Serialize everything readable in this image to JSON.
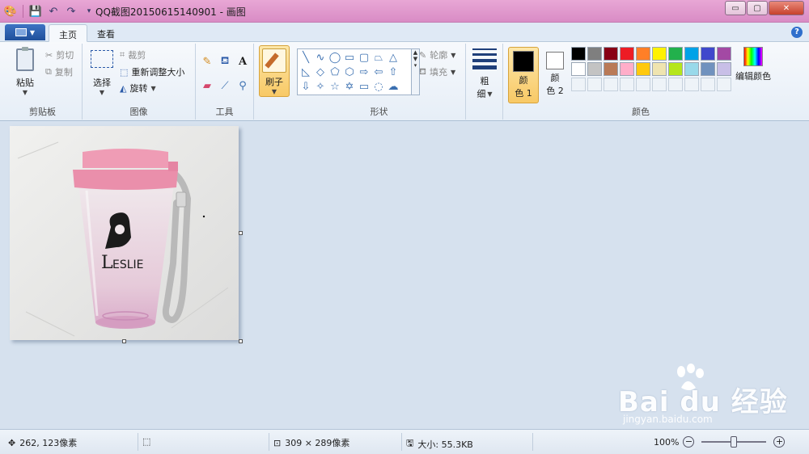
{
  "titlebar": {
    "title": "QQ截图20150615140901 - 画图",
    "controls": {
      "minimize": "▭",
      "maximize": "▢",
      "close": "✕"
    }
  },
  "tabs": {
    "main": "主页",
    "view": "查看",
    "help": "?"
  },
  "clipboard": {
    "paste": "粘贴",
    "cut": "剪切",
    "copy": "复制",
    "label": "剪贴板"
  },
  "image_group": {
    "select": "选择",
    "crop": "裁剪",
    "resize": "重新调整大小",
    "rotate": "旋转",
    "label": "图像"
  },
  "tools_group": {
    "label": "工具",
    "text_tool": "A"
  },
  "brush": {
    "label": "刷子"
  },
  "shapes_group": {
    "outline": "轮廓",
    "fill": "填充",
    "label": "形状"
  },
  "size_group": {
    "line1": "粗",
    "line2": "细"
  },
  "colors_group": {
    "color1_line1": "颜",
    "color1_line2": "色 1",
    "color2_line1": "颜",
    "color2_line2": "色 2",
    "color1_value": "#000000",
    "color2_value": "#ffffff",
    "edit_colors": "编辑颜色",
    "label": "颜色",
    "palette_row1": [
      "#000000",
      "#7f7f7f",
      "#880015",
      "#ed1c24",
      "#ff7f27",
      "#fff200",
      "#22b14c",
      "#00a2e8",
      "#3f48cc",
      "#a349a4"
    ],
    "palette_row2": [
      "#ffffff",
      "#c3c3c3",
      "#b97a57",
      "#ffaec9",
      "#ffc90e",
      "#efe4b0",
      "#b5e61d",
      "#99d9ea",
      "#7092be",
      "#c8bfe7"
    ]
  },
  "canvas": {
    "logo_text": "ESLIE",
    "logo_initial": "L"
  },
  "statusbar": {
    "cursor_pos": "262, 123像素",
    "image_size": "309 × 289像素",
    "file_size": "大小: 55.3KB",
    "zoom": "100%",
    "zoom_level_fraction": 0.5
  },
  "watermark": {
    "brand": "Bai du 经验",
    "url": "jingyan.baidu.com"
  }
}
